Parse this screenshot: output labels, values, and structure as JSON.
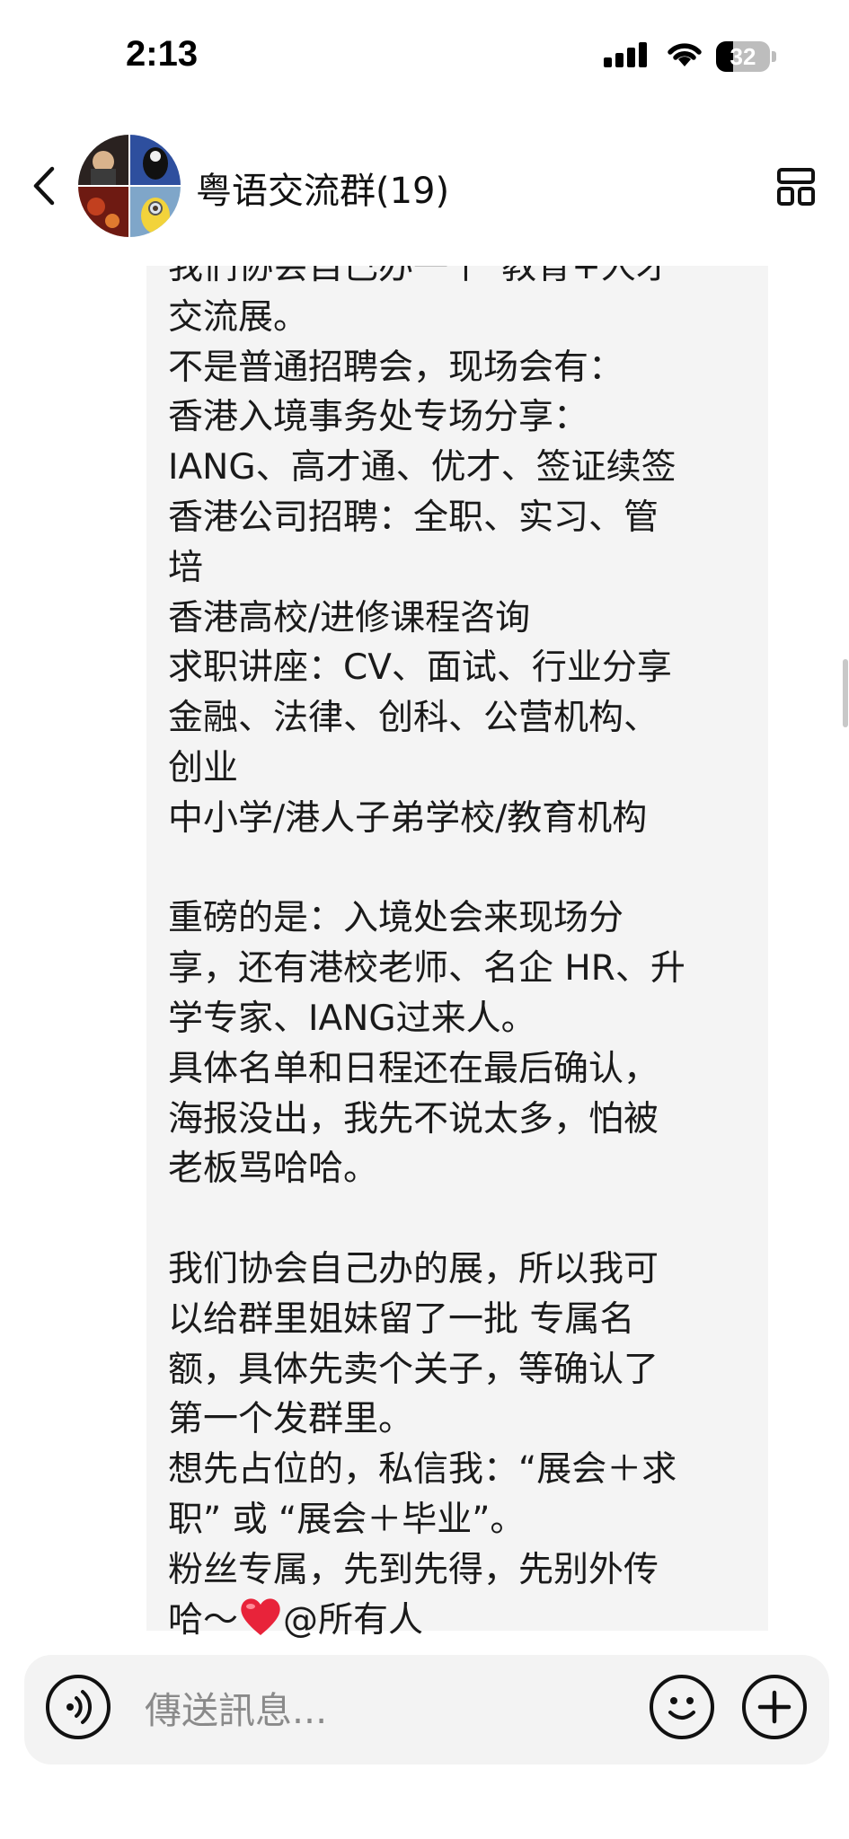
{
  "status_bar": {
    "time": "2:13",
    "battery_level": "32",
    "icons": [
      "signal-icon",
      "wifi-icon",
      "battery-icon"
    ]
  },
  "header": {
    "group_name": "粤语交流群(19)",
    "back_icon": "chevron-left-icon",
    "menu_icon": "grid-menu-icon"
  },
  "message": {
    "text": "我们协会自己办一个“教育+人才\n交流展。\n不是普通招聘会，现场会有：\n香港入境事务处专场分享：\nIANG、高才通、优才、签证续签\n香港公司招聘：全职、实习、管\n培\n香港高校/进修课程咨询\n求职讲座：CV、面试、行业分享\n金融、法律、创科、公营机构、\n创业\n中小学/港人子弟学校/教育机构\n\n重磅的是：入境处会来现场分\n享，还有港校老师、名企 HR、升\n学专家、IANG过来人。\n具体名单和日程还在最后确认，\n海报没出，我先不说太多，怕被\n老板骂哈哈。\n\n我们协会自己办的展，所以我可\n以给群里姐妹留了一批 专属名\n额，具体先卖个关子，等确认了\n第一个发群里。\n想先占位的，私信我：“展会＋求\n职” 或 “展会＋毕业”。\n粉丝专属，先到先得，先别外传\n哈～",
    "emoji": "red-heart",
    "mention": "@所有人"
  },
  "input": {
    "placeholder": "傳送訊息...",
    "value": "",
    "voice_icon": "voice-icon",
    "emoji_icon": "smiley-icon",
    "add_icon": "plus-icon"
  },
  "colors": {
    "bubble": "#f4f4f4",
    "input_bar": "#f3f3f3",
    "text": "#1a1a1a",
    "heart": "#e8233a"
  }
}
